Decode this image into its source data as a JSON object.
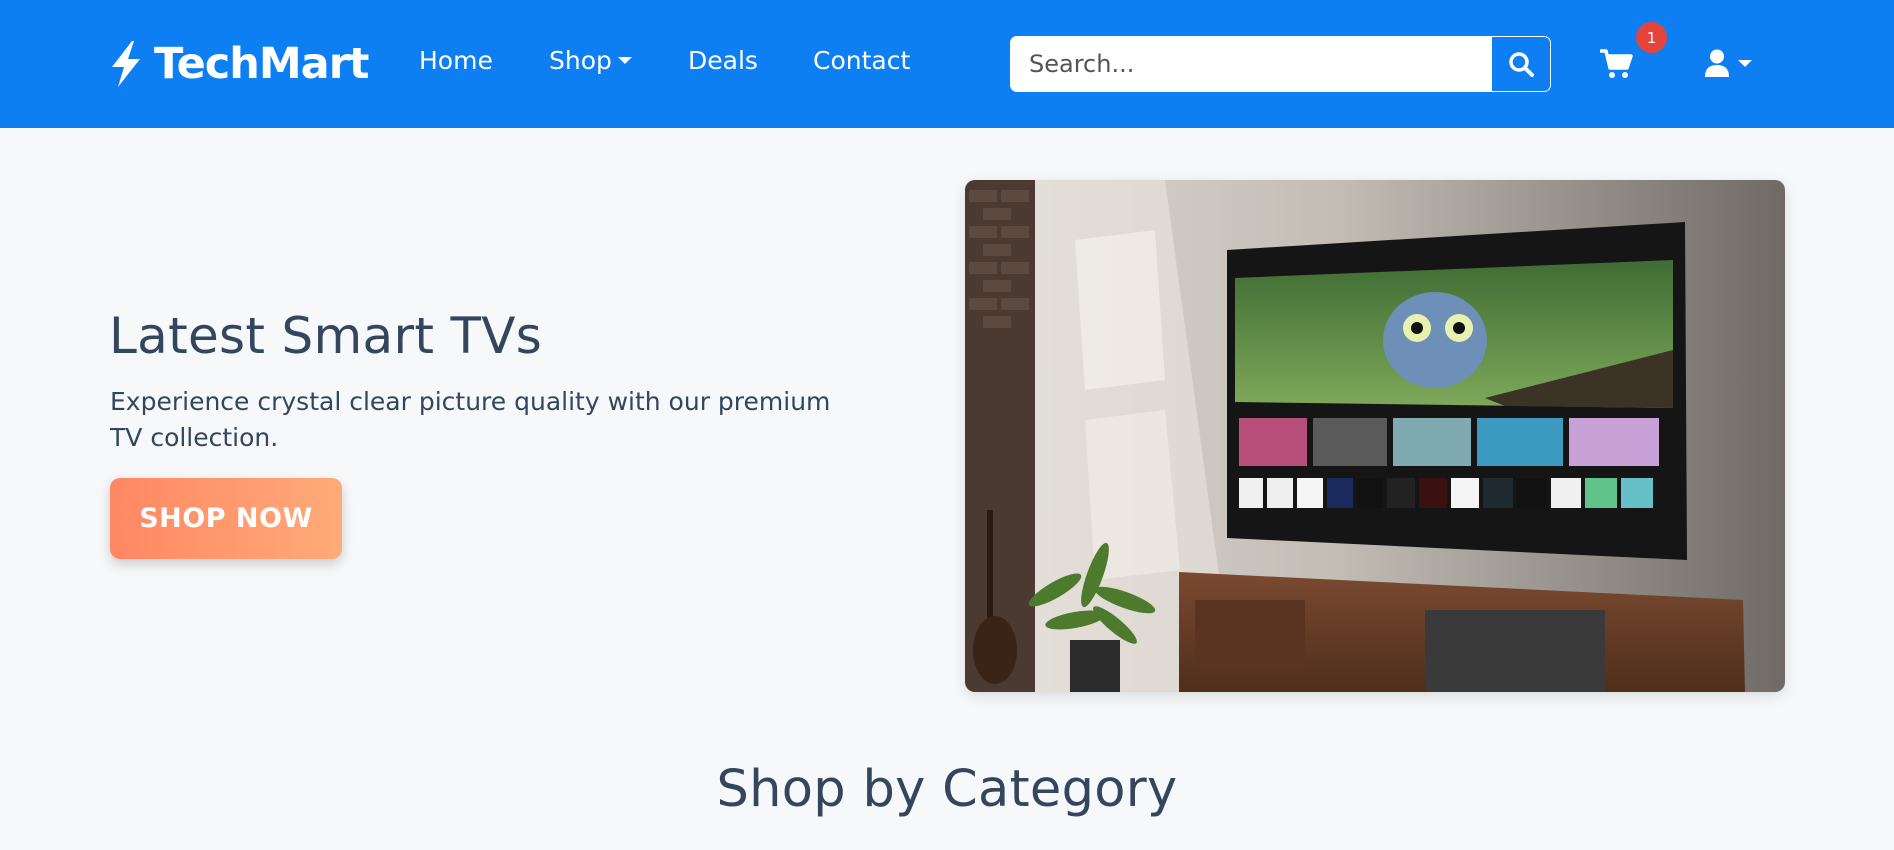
{
  "brand": {
    "name": "TechMart",
    "icon": "lightning-bolt-icon"
  },
  "nav": {
    "home": "Home",
    "shop": "Shop",
    "deals": "Deals",
    "contact": "Contact"
  },
  "search": {
    "placeholder": "Search...",
    "value": "",
    "icon": "search-icon"
  },
  "cart": {
    "icon": "cart-icon",
    "count": "1"
  },
  "user": {
    "icon": "user-icon"
  },
  "hero": {
    "title": "Latest Smart TVs",
    "text": "Experience crystal clear picture quality with our premium TV collection.",
    "button": "SHOP NOW"
  },
  "categories": {
    "title": "Shop by Category"
  },
  "colors": {
    "primary": "#0d7ff2",
    "accent_start": "#ff8763",
    "accent_end": "#ffab78",
    "badge": "#e5443c",
    "text": "#34465e"
  }
}
